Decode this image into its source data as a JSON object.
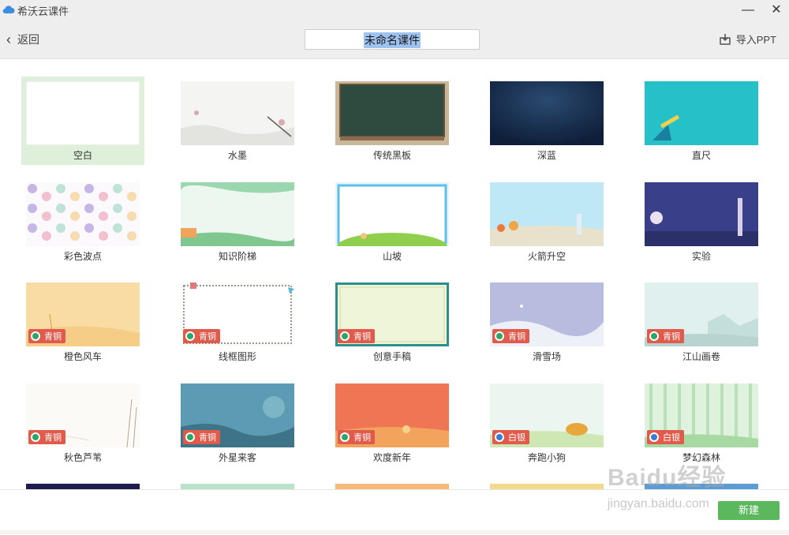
{
  "app": {
    "title": "希沃云课件",
    "minimize_glyph": "—",
    "close_glyph": "✕"
  },
  "toolbar": {
    "back_label": "返回",
    "course_name": "未命名课件",
    "import_label": "导入PPT"
  },
  "templates": [
    {
      "label": "空白",
      "theme": "blank",
      "selected": true
    },
    {
      "label": "水墨",
      "theme": "ink"
    },
    {
      "label": "传统黑板",
      "theme": "blackboard"
    },
    {
      "label": "深蓝",
      "theme": "deepblue"
    },
    {
      "label": "直尺",
      "theme": "ruler"
    },
    {
      "label": "彩色波点",
      "theme": "dots"
    },
    {
      "label": "知识阶梯",
      "theme": "ladder"
    },
    {
      "label": "山坡",
      "theme": "hill"
    },
    {
      "label": "火箭升空",
      "theme": "rocket"
    },
    {
      "label": "实验",
      "theme": "lab"
    },
    {
      "label": "橙色风车",
      "theme": "windmill",
      "badge": "青铜"
    },
    {
      "label": "线框图形",
      "theme": "frame",
      "badge": "青铜"
    },
    {
      "label": "创意手稿",
      "theme": "manuscript",
      "badge": "青铜"
    },
    {
      "label": "滑雪场",
      "theme": "ski",
      "badge": "青铜"
    },
    {
      "label": "江山画卷",
      "theme": "landscape",
      "badge": "青铜"
    },
    {
      "label": "秋色芦苇",
      "theme": "reed",
      "badge": "青铜"
    },
    {
      "label": "外星来客",
      "theme": "alien",
      "badge": "青铜"
    },
    {
      "label": "欢度新年",
      "theme": "newyear",
      "badge": "青铜"
    },
    {
      "label": "奔跑小狗",
      "theme": "dog",
      "badge": "白银"
    },
    {
      "label": "梦幻森林",
      "theme": "forest",
      "badge": "白银"
    }
  ],
  "footer": {
    "new_label": "新建"
  },
  "watermark": {
    "text": "Baidu经验",
    "url": "jingyan.baidu.com"
  },
  "colors": {
    "accent": "#5cb85c",
    "badge": "#e05b4b",
    "selected_bg": "#dff0da"
  }
}
